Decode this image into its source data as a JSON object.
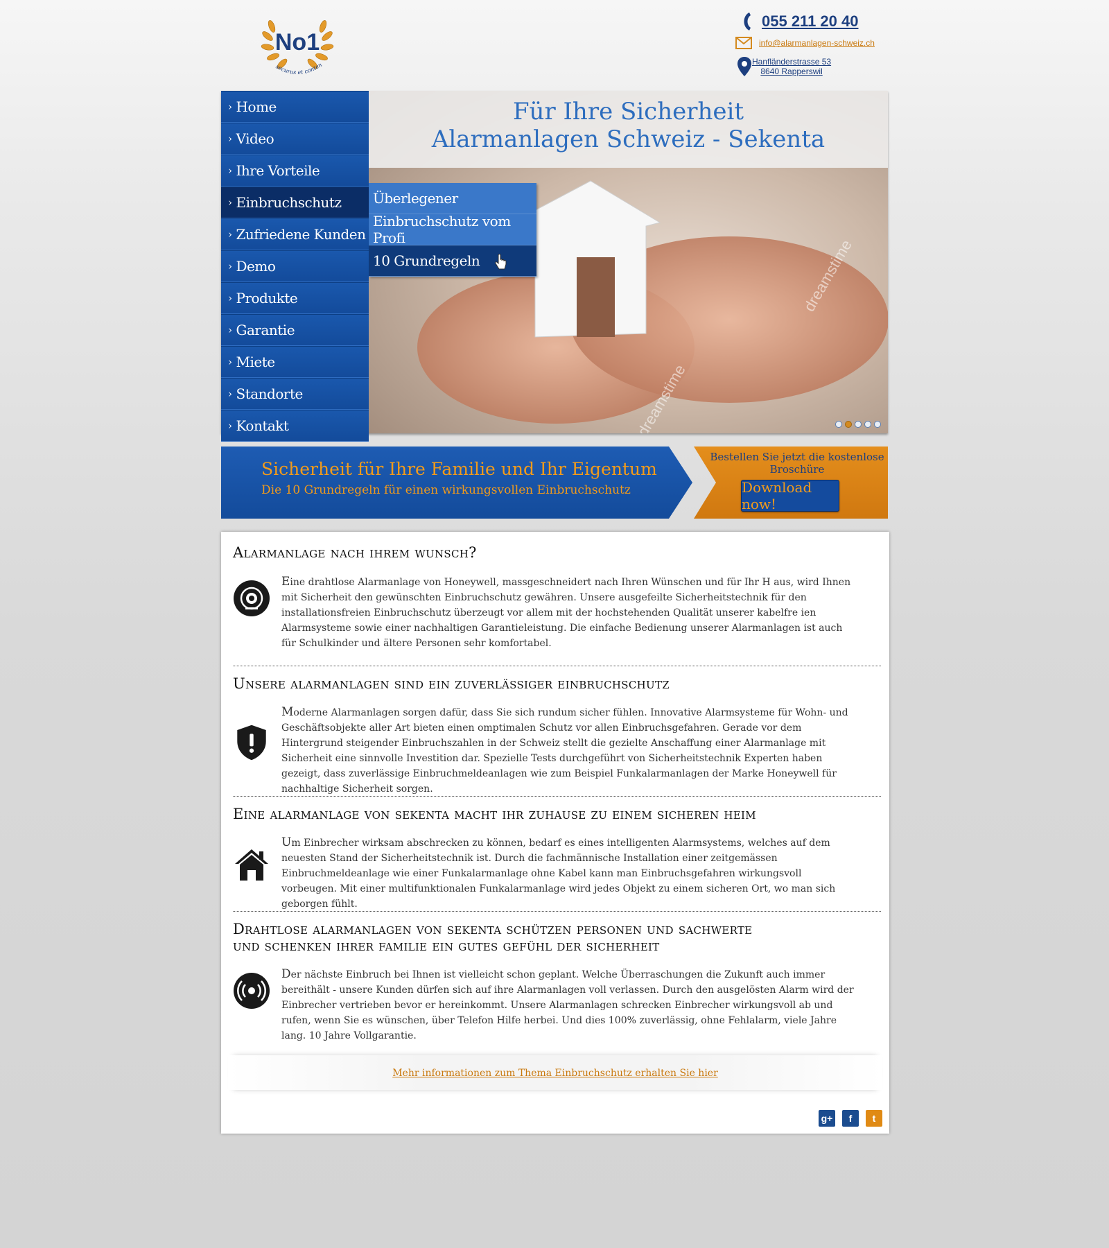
{
  "header": {
    "logo_text": "No1",
    "logo_motto": "securus et contentus",
    "phone": "055 211 20 40",
    "email": "info@alarmanlagen-schweiz.ch",
    "address_line1": "Hanfländerstrasse 53",
    "address_line2": "8640 Rapperswil"
  },
  "nav": {
    "items": [
      {
        "label": "Home"
      },
      {
        "label": "Video"
      },
      {
        "label": "Ihre Vorteile"
      },
      {
        "label": "Einbruchschutz"
      },
      {
        "label": "Zufriedene Kunden"
      },
      {
        "label": "Demo"
      },
      {
        "label": "Produkte"
      },
      {
        "label": "Garantie"
      },
      {
        "label": "Miete"
      },
      {
        "label": "Standorte"
      },
      {
        "label": "Kontakt"
      }
    ],
    "active": "Einbruchschutz",
    "dropdown": [
      {
        "label": "Überlegener"
      },
      {
        "label": "Einbruchschutz vom Profi"
      },
      {
        "label": "10 Grundregeln"
      }
    ]
  },
  "hero": {
    "title_line1": "Für Ihre Sicherheit",
    "title_line2": "Alarmanlagen Schweiz - Sekenta",
    "watermark": "dreamstime",
    "slide_count": 5,
    "active_slide": 2
  },
  "banner": {
    "title": "Sicherheit für Ihre Familie und Ihr Eigentum",
    "subtitle": "Die 10 Grundregeln für einen wirkungsvollen Einbruchschutz",
    "promo_text": "Bestellen Sie jetzt die kostenlose Broschüre",
    "download_label": "Download  now!"
  },
  "sections": [
    {
      "title": "Alarmanlage nach ihrem wunsch?",
      "icon": "alarm-siren-icon",
      "text": "Eine drahtlose Alarmanlage von Honeywell, massgeschneidert nach Ihren Wünschen und für Ihr H aus, wird Ihnen mit Sicherheit den gewünschten Einbruchschutz gewähren. Unsere ausgefeilte Sicherheitstechnik für den installationsfreien Einbruchschutz überzeugt vor allem mit der hochstehenden Qualität unserer kabelfre   ien Alarmsysteme sowie einer nachhaltigen Garantieleistung. Die einfache Bedienung unserer Alarmanlagen ist auch für Schulkinder und ältere Personen sehr komfortabel."
    },
    {
      "title": "Unsere alarmanlagen sind ein zuverlässiger einbruchschutz",
      "icon": "shield-warning-icon",
      "text": "Moderne Alarmanlagen sorgen dafür, dass Sie sich rundum sicher fühlen. Innovative Alarmsysteme für Wohn- und Geschäftsobjekte aller Art bieten einen omptimalen Schutz vor allen Einbruchsgefahren. Gerade vor dem Hintergrund steigender Einbruchszahlen in der Schweiz stellt die gezielte Anschaffung einer Alarmanlage mit Sicherheit eine sinnvolle Investition dar. Spezielle Tests durchgeführt von Sicherheitstechnik Experten haben gezeigt, dass zuverlässige Einbruchmeldeanlagen wie zum Beispiel Funkalarmanlagen der Marke Honeywell für nachhaltige Sicherheit sorgen."
    },
    {
      "title": "Eine alarmanlage von sekenta macht ihr zuhause zu einem sicheren heim",
      "icon": "house-icon",
      "text": "Um Einbrecher wirksam abschrecken zu können, bedarf es eines intelligenten Alarmsystems, welches auf dem neuesten Stand der Sicherheitstechnik ist. Durch die fachmännische Installation einer zeitgemässen Einbruchmeldeanlage wie einer Funkalarmanlage ohne Kabel kann man Einbruchsgefahren wirkungsvoll vorbeugen. Mit einer multifunktionalen Funkalarmanlage wird jedes Objekt zu einem sicheren Ort, wo man sich geborgen fühlt."
    },
    {
      "title": "Drahtlose alarmanlagen von sekenta schützen personen und sachwerte",
      "title_line2": "und schenken ihrer familie ein gutes gefühl der sicherheit",
      "icon": "wireless-signal-icon",
      "text": "Der nächste Einbruch bei Ihnen ist vielleicht schon geplant. Welche Überraschungen die Zukunft auch immer bereithält - unsere Kunden dürfen sich auf ihre Alarmanlagen voll verlassen. Durch den ausgelösten Alarm wird der Einbrecher vertrieben bevor er hereinkommt. Unsere Alarmanlagen schrecken Einbrecher wirkungsvoll ab und rufen, wenn Sie es wünschen, über Telefon Hilfe herbei. Und dies 100% zuverlässig, ohne Fehlalarm, viele Jahre lang. 10 Jahre Vollgarantie."
    }
  ],
  "more_link": "Mehr informationen zum Thema Einbruchschutz erhalten Sie hier",
  "social": [
    {
      "name": "google-plus-icon",
      "glyph": "g+",
      "color": "#1b4c8f"
    },
    {
      "name": "facebook-icon",
      "glyph": "f",
      "color": "#1b4c8f"
    },
    {
      "name": "twitter-icon",
      "glyph": "t",
      "color": "#e08a14"
    }
  ],
  "colors": {
    "nav_blue": "#1753a6",
    "active_nav": "#0b2d66",
    "accent_orange": "#f29b1b",
    "title_blue": "#2d6dbe"
  }
}
